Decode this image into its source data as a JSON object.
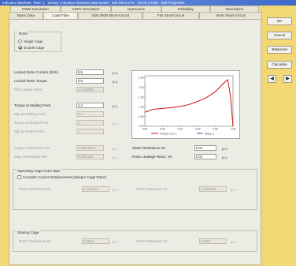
{
  "window": {
    "title": "Induction Machine, Time: 1 · Library: Induction Machine Data Model · 400 kW 6.6 kV · 50 Hz 6 Pole · Edit Properties"
  },
  "tabs_row1": [
    {
      "label": "PWM Simulation"
    },
    {
      "label": "VSPC Simulation"
    },
    {
      "label": "Harmonics"
    },
    {
      "label": "Reliability"
    },
    {
      "label": "Description"
    }
  ],
  "tabs_row2": [
    {
      "label": "Basic Data"
    },
    {
      "label": "Load Flow"
    },
    {
      "label": "VDE 0530 Short-Circuit"
    },
    {
      "label": "Full Short-Circuit"
    },
    {
      "label": "ANSI Short-Circuit"
    }
  ],
  "rotor": {
    "title": "Rotor",
    "single_cage": "Single Cage",
    "double_cage": "Double Cage",
    "selected": "Double Cage"
  },
  "fields": {
    "locked_rotor_current": {
      "label": "Locked Rotor Current (Ilr/In)",
      "value": "5.5",
      "unit": "p.u."
    },
    "locked_rotor_torque": {
      "label": "Locked Rotor Torque",
      "value": "0.5",
      "unit": "p.u."
    },
    "r_x_locked_rotor": {
      "label": "R/X Locked Rotor",
      "value": "0.1038098",
      "unit": ""
    },
    "torque_stalling_point": {
      "label": "Torque at Stalling Point",
      "value": "2.4",
      "unit": "p.u."
    },
    "slip_stalling_point": {
      "label": "Slip at Stalling Point",
      "value": "8.3",
      "unit": ""
    },
    "torque_rated_point": {
      "label": "Torque at Rated Point",
      "value": "1",
      "unit": "p.u."
    },
    "slip_rated_point": {
      "label": "Slip at Rated Point",
      "value": "1",
      "unit": ""
    },
    "copper_losses": {
      "label": "Copper Resistance Rs",
      "value": "0.00896573",
      "unit": "p.u."
    },
    "mag_resistance": {
      "label": "Mag. Resistance Rm",
      "value": "0.0051836",
      "unit": "p.u."
    },
    "stator_resistance": {
      "label": "Stator Resistance Rs",
      "value": "0.01",
      "unit": "p.u."
    },
    "rotor_leakage": {
      "label": "Rotor Leakage React. Xrl",
      "value": "0.01",
      "unit": "p.u."
    }
  },
  "operating_cage": {
    "title": "Operating Cage Rotor data",
    "checkbox": "Consider Current Displacement (Deeper Cage Rotor)",
    "rotor_resistance_label": "Rotor Resistance Rr",
    "rotor_resistance_value": "0.0113457",
    "rotor_reactance_label": "Rotor Reactance Xr",
    "rotor_reactance_value": "0.1006882",
    "unit": "p.u."
  },
  "starting_cage": {
    "title": "Starting Cage",
    "rotor_resistance_label": "Rotor Resistance Rr",
    "rotor_resistance_value": "0.0512",
    "rotor_reactance_label": "Rotor Reactance Xr",
    "rotor_reactance_value": "0.0867",
    "unit": "p.u."
  },
  "chart": {
    "legend_torque": "Torque in p.u.",
    "legend_speed": "Slip/p.u.",
    "y_ticks": [
      "2.50",
      "2.00",
      "1.50",
      "1.00",
      "0.50",
      "0.00"
    ],
    "x_ticks": [
      "0.00",
      "0.20",
      "0.40",
      "0.60",
      "0.80",
      "1.00"
    ],
    "curve_color": "#cc1010"
  },
  "chart_data": {
    "type": "line",
    "series": [
      {
        "x": [
          0.0,
          0.1,
          0.2,
          0.3,
          0.4,
          0.5,
          0.6,
          0.7,
          0.8,
          0.9,
          0.94,
          0.97,
          1.0
        ],
        "y": [
          0.72,
          0.88,
          0.92,
          0.96,
          1.02,
          1.12,
          1.28,
          1.48,
          1.78,
          2.25,
          2.4,
          1.6,
          0.0
        ]
      }
    ],
    "xlim": [
      0.0,
      1.0
    ],
    "ylim": [
      0.0,
      2.6
    ]
  },
  "buttons": {
    "ok": "OK",
    "cancel": "Cancel",
    "balanced": "Balanced",
    "calculate": "Calculate",
    "prev": "◀",
    "next": "▶"
  }
}
